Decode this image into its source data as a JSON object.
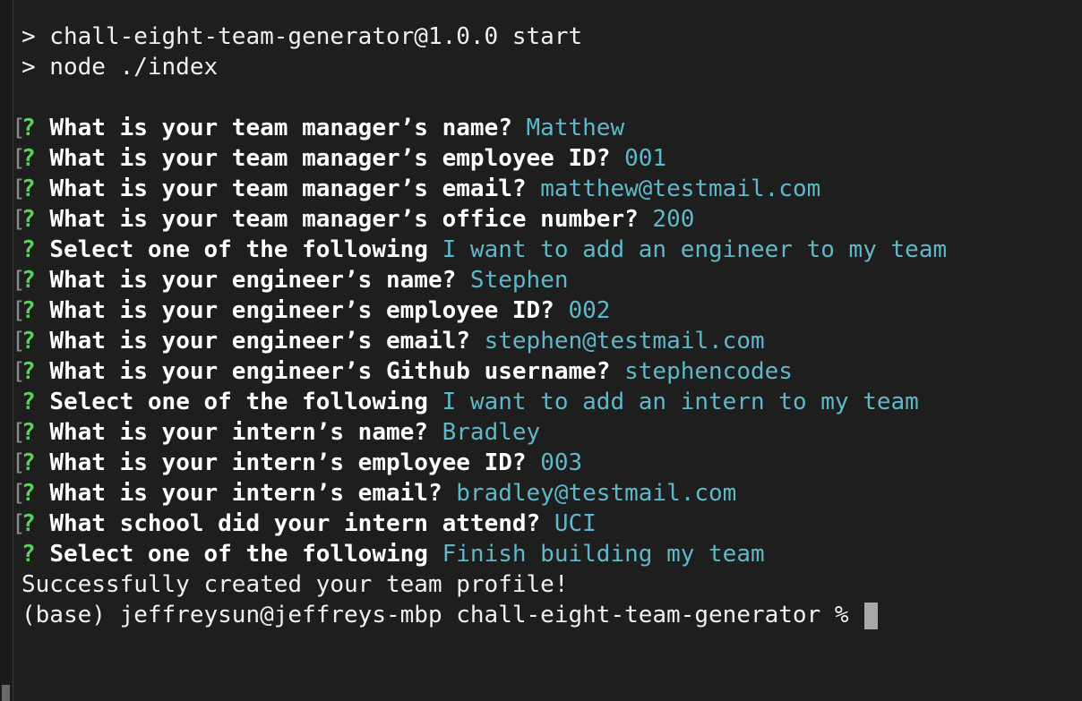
{
  "header": [
    "> chall-eight-team-generator@1.0.0 start",
    "> node ./index"
  ],
  "prompts": [
    {
      "bracket": true,
      "q": "?",
      "question": "What is your team manager’s name?",
      "answer": "Matthew"
    },
    {
      "bracket": true,
      "q": "?",
      "question": "What is your team manager’s employee ID?",
      "answer": "001"
    },
    {
      "bracket": true,
      "q": "?",
      "question": "What is your team manager’s email?",
      "answer": "matthew@testmail.com"
    },
    {
      "bracket": true,
      "q": "?",
      "question": "What is your team manager’s office number?",
      "answer": "200"
    },
    {
      "bracket": false,
      "q": "?",
      "question": "Select one of the following",
      "answer": "I want to add an engineer to my team"
    },
    {
      "bracket": true,
      "q": "?",
      "question": "What is your engineer’s name?",
      "answer": "Stephen"
    },
    {
      "bracket": true,
      "q": "?",
      "question": "What is your engineer’s employee ID?",
      "answer": "002"
    },
    {
      "bracket": true,
      "q": "?",
      "question": "What is your engineer’s email?",
      "answer": "stephen@testmail.com"
    },
    {
      "bracket": true,
      "q": "?",
      "question": "What is your engineer’s Github username?",
      "answer": "stephencodes"
    },
    {
      "bracket": false,
      "q": "?",
      "question": "Select one of the following",
      "answer": "I want to add an intern to my team"
    },
    {
      "bracket": true,
      "q": "?",
      "question": "What is your intern’s name?",
      "answer": "Bradley"
    },
    {
      "bracket": true,
      "q": "?",
      "question": "What is your intern’s employee ID?",
      "answer": "003"
    },
    {
      "bracket": true,
      "q": "?",
      "question": "What is your intern’s email?",
      "answer": "bradley@testmail.com"
    },
    {
      "bracket": true,
      "q": "?",
      "question": "What school did your intern attend?",
      "answer": "UCI"
    },
    {
      "bracket": false,
      "q": "?",
      "question": "Select one of the following",
      "answer": "Finish building my team"
    }
  ],
  "success_message": "Successfully created your team profile!",
  "shell_prompt": "(base) jeffreysun@jeffreys-mbp chall-eight-team-generator % ",
  "gutter_glyph": "[",
  "colors": {
    "background": "#1e1e1e",
    "question_mark": "#5cd05c",
    "answer": "#5fb8c8",
    "text": "#f0f0f0",
    "cursor": "#a8a8a8"
  }
}
